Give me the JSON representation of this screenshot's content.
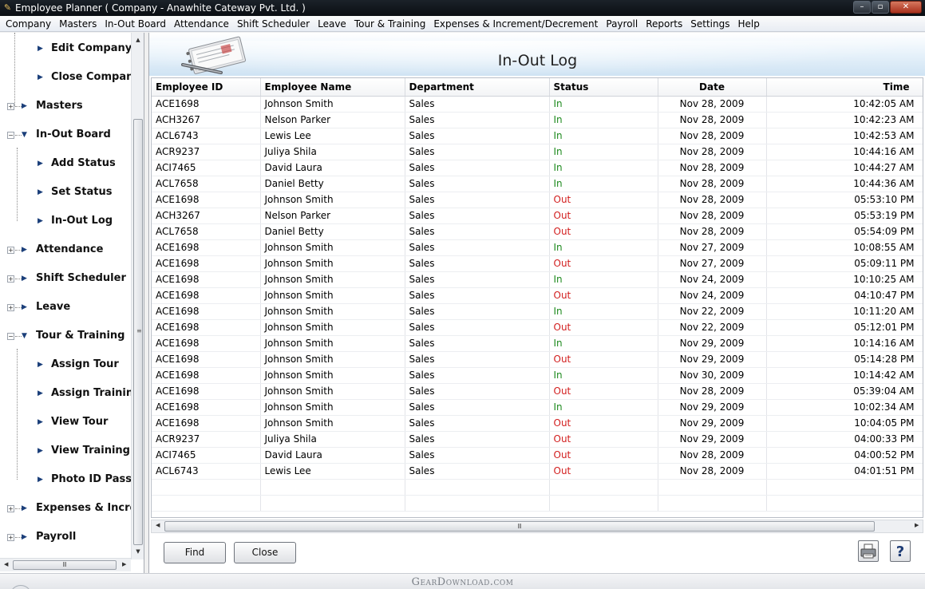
{
  "window": {
    "title": "Employee Planner ( Company - Anawhite Cateway Pvt. Ltd. )"
  },
  "menu": [
    "Company",
    "Masters",
    "In-Out Board",
    "Attendance",
    "Shift Scheduler",
    "Leave",
    "Tour & Training",
    "Expenses & Increment/Decrement",
    "Payroll",
    "Reports",
    "Settings",
    "Help"
  ],
  "sidebar": {
    "items": [
      {
        "label": "Edit Company",
        "level": 1
      },
      {
        "label": "Close Company",
        "level": 1
      },
      {
        "label": "Masters",
        "level": 0
      },
      {
        "label": "In-Out Board",
        "level": 0,
        "expanded": true
      },
      {
        "label": "Add Status",
        "level": 1
      },
      {
        "label": "Set Status",
        "level": 1
      },
      {
        "label": "In-Out Log",
        "level": 1
      },
      {
        "label": "Attendance",
        "level": 0
      },
      {
        "label": "Shift Scheduler",
        "level": 0
      },
      {
        "label": "Leave",
        "level": 0
      },
      {
        "label": "Tour & Training",
        "level": 0,
        "expanded": true
      },
      {
        "label": "Assign Tour",
        "level": 1
      },
      {
        "label": "Assign Training",
        "level": 1
      },
      {
        "label": "View Tour",
        "level": 1
      },
      {
        "label": "View Training",
        "level": 1
      },
      {
        "label": "Photo ID Pass",
        "level": 1
      },
      {
        "label": "Expenses & Increment/Decrement",
        "level": 0
      },
      {
        "label": "Payroll",
        "level": 0
      }
    ]
  },
  "main": {
    "title": "In-Out Log",
    "columns": [
      "Employee ID",
      "Employee Name",
      "Department",
      "Status",
      "Date",
      "Time"
    ],
    "rows": [
      [
        "ACE1698",
        "Johnson Smith",
        "Sales",
        "In",
        "Nov 28, 2009",
        "10:42:05 AM"
      ],
      [
        "ACH3267",
        "Nelson Parker",
        "Sales",
        "In",
        "Nov 28, 2009",
        "10:42:23 AM"
      ],
      [
        "ACL6743",
        "Lewis Lee",
        "Sales",
        "In",
        "Nov 28, 2009",
        "10:42:53 AM"
      ],
      [
        "ACR9237",
        "Juliya Shila",
        "Sales",
        "In",
        "Nov 28, 2009",
        "10:44:16 AM"
      ],
      [
        "ACI7465",
        "David Laura",
        "Sales",
        "In",
        "Nov 28, 2009",
        "10:44:27 AM"
      ],
      [
        "ACL7658",
        "Daniel Betty",
        "Sales",
        "In",
        "Nov 28, 2009",
        "10:44:36 AM"
      ],
      [
        "ACE1698",
        "Johnson Smith",
        "Sales",
        "Out",
        "Nov 28, 2009",
        "05:53:10 PM"
      ],
      [
        "ACH3267",
        "Nelson Parker",
        "Sales",
        "Out",
        "Nov 28, 2009",
        "05:53:19 PM"
      ],
      [
        "ACL7658",
        "Daniel Betty",
        "Sales",
        "Out",
        "Nov 28, 2009",
        "05:54:09 PM"
      ],
      [
        "ACE1698",
        "Johnson Smith",
        "Sales",
        "In",
        "Nov 27, 2009",
        "10:08:55 AM"
      ],
      [
        "ACE1698",
        "Johnson Smith",
        "Sales",
        "Out",
        "Nov 27, 2009",
        "05:09:11 PM"
      ],
      [
        "ACE1698",
        "Johnson Smith",
        "Sales",
        "In",
        "Nov 24, 2009",
        "10:10:25 AM"
      ],
      [
        "ACE1698",
        "Johnson Smith",
        "Sales",
        "Out",
        "Nov 24, 2009",
        "04:10:47 PM"
      ],
      [
        "ACE1698",
        "Johnson Smith",
        "Sales",
        "In",
        "Nov 22, 2009",
        "10:11:20 AM"
      ],
      [
        "ACE1698",
        "Johnson Smith",
        "Sales",
        "Out",
        "Nov 22, 2009",
        "05:12:01 PM"
      ],
      [
        "ACE1698",
        "Johnson Smith",
        "Sales",
        "In",
        "Nov 29, 2009",
        "10:14:16 AM"
      ],
      [
        "ACE1698",
        "Johnson Smith",
        "Sales",
        "Out",
        "Nov 29, 2009",
        "05:14:28 PM"
      ],
      [
        "ACE1698",
        "Johnson Smith",
        "Sales",
        "In",
        "Nov 30, 2009",
        "10:14:42 AM"
      ],
      [
        "ACE1698",
        "Johnson Smith",
        "Sales",
        "Out",
        "Nov 28, 2009",
        "05:39:04 AM"
      ],
      [
        "ACE1698",
        "Johnson Smith",
        "Sales",
        "In",
        "Nov 29, 2009",
        "10:02:34 AM"
      ],
      [
        "ACE1698",
        "Johnson Smith",
        "Sales",
        "Out",
        "Nov 29, 2009",
        "10:04:05 PM"
      ],
      [
        "ACR9237",
        "Juliya Shila",
        "Sales",
        "Out",
        "Nov 29, 2009",
        "04:00:33 PM"
      ],
      [
        "ACI7465",
        "David Laura",
        "Sales",
        "Out",
        "Nov 28, 2009",
        "04:00:52 PM"
      ],
      [
        "ACL6743",
        "Lewis Lee",
        "Sales",
        "Out",
        "Nov 28, 2009",
        "04:01:51 PM"
      ]
    ],
    "empty_rows": 2,
    "buttons": {
      "find": "Find",
      "close": "Close"
    }
  },
  "footer": {
    "watermark": "GearDownload.com"
  },
  "colors": {
    "status_in": "#1e8a1e",
    "status_out": "#d21e1e",
    "titlebar": "#0f1419"
  }
}
